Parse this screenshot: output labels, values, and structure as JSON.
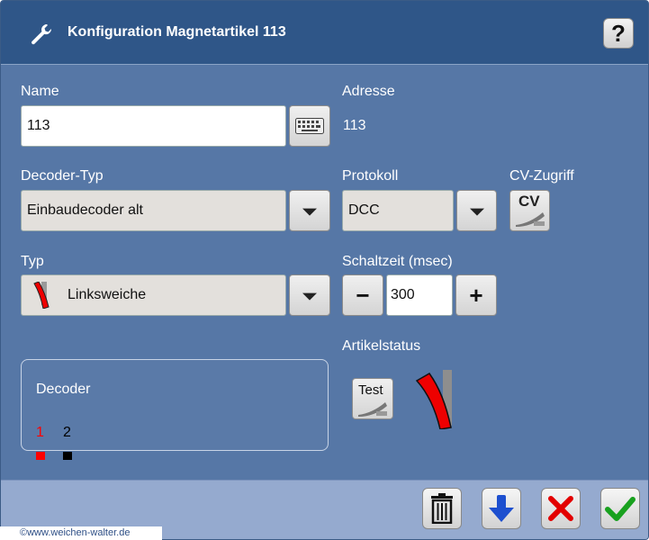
{
  "dialog": {
    "title": "Konfiguration Magnetartikel 113",
    "help_label": "?"
  },
  "name": {
    "label": "Name",
    "value": "113"
  },
  "address": {
    "label": "Adresse",
    "value": "113"
  },
  "decoder_type": {
    "label": "Decoder-Typ",
    "value": "Einbaudecoder alt"
  },
  "protocol": {
    "label": "Protokoll",
    "value": "DCC"
  },
  "cv_access": {
    "label": "CV-Zugriff",
    "button_label": "CV"
  },
  "type": {
    "label": "Typ",
    "value": "Linksweiche"
  },
  "switch_time": {
    "label": "Schaltzeit (msec)",
    "value": "300",
    "minus": "−",
    "plus": "+"
  },
  "article_status": {
    "label": "Artikelstatus",
    "test_label": "Test"
  },
  "decoder": {
    "label": "Decoder",
    "outputs": [
      {
        "number": "1",
        "color": "#ff0000"
      },
      {
        "number": "2",
        "color": "#000000"
      }
    ]
  },
  "footer": {
    "icons": [
      "trash-icon",
      "arrow-down-icon",
      "close-icon",
      "check-icon"
    ]
  },
  "copyright": "©www.weichen-walter.de",
  "colors": {
    "titlebar": "#2f5688",
    "panel": "#5677a6",
    "footer": "#95aacf",
    "active_output": "#ff0000"
  }
}
